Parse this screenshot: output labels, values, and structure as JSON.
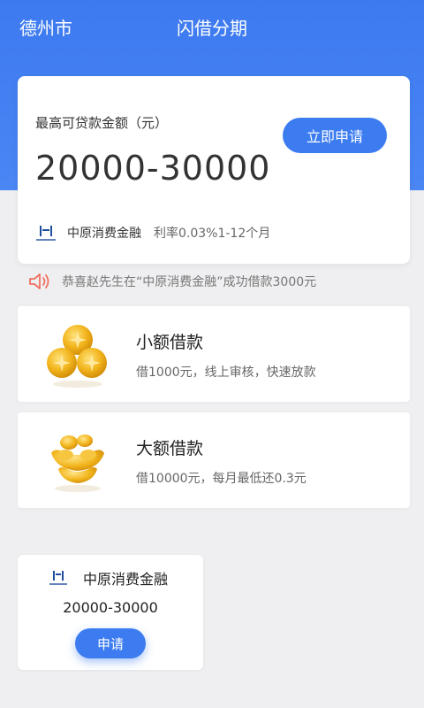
{
  "header": {
    "city": "德州市",
    "title": "闪借分期"
  },
  "main_card": {
    "limit_label": "最高可贷款金额（元）",
    "amount": "20000-30000",
    "apply_label": "立即申请",
    "lender_name": "中原消费金融",
    "rate_text": "利率0.03%1-12个月"
  },
  "notice": {
    "text": "恭喜赵先生在“中原消费金融”成功借款3000元"
  },
  "loan_options": [
    {
      "title": "小额借款",
      "desc": "借1000元，线上审核，快速放款",
      "icon": "coins-icon"
    },
    {
      "title": "大额借款",
      "desc": "借10000元，每月最低还0.3元",
      "icon": "gold-ingots-icon"
    }
  ],
  "product": {
    "name": "中原消费金融",
    "amount": "20000-30000",
    "apply_label": "申请"
  },
  "colors": {
    "primary": "#3c7cf0",
    "header_bg": "#4a86f4",
    "page_bg": "#efeff1",
    "speaker": "#f07060",
    "gold": "#f2b51d"
  }
}
